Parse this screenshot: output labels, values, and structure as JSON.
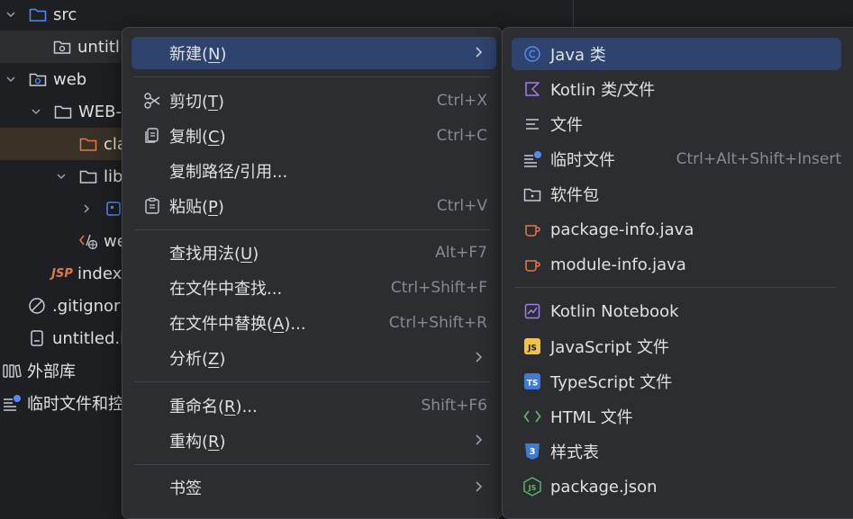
{
  "tree": {
    "items": [
      {
        "label": "src"
      },
      {
        "label": "untitl"
      },
      {
        "label": "web"
      },
      {
        "label": "WEB-"
      },
      {
        "label": "cla"
      },
      {
        "label": "lib"
      },
      {
        "label": ""
      },
      {
        "label": "we"
      },
      {
        "label": "index"
      },
      {
        "label": ".gitignor"
      },
      {
        "label": "untitled.i"
      },
      {
        "label": "外部库"
      },
      {
        "label": "临时文件和控"
      }
    ]
  },
  "menu1": {
    "new": {
      "label": "新建(",
      "mnemonic": "N",
      "suffix": ")"
    },
    "cut": {
      "label": "剪切(",
      "mnemonic": "T",
      "suffix": ")",
      "shortcut": "Ctrl+X"
    },
    "copy": {
      "label": "复制(",
      "mnemonic": "C",
      "suffix": ")",
      "shortcut": "Ctrl+C"
    },
    "copy_path": {
      "label": "复制路径/引用..."
    },
    "paste": {
      "label": "粘贴(",
      "mnemonic": "P",
      "suffix": ")",
      "shortcut": "Ctrl+V"
    },
    "find_usages": {
      "label": "查找用法(",
      "mnemonic": "U",
      "suffix": ")",
      "shortcut": "Alt+F7"
    },
    "find_in_files": {
      "label": "在文件中查找...",
      "shortcut": "Ctrl+Shift+F"
    },
    "replace_in_files": {
      "label": "在文件中替换(",
      "mnemonic": "A",
      "suffix": ")...",
      "shortcut": "Ctrl+Shift+R"
    },
    "analyze": {
      "label": "分析(",
      "mnemonic": "Z",
      "suffix": ")"
    },
    "rename": {
      "label": "重命名(",
      "mnemonic": "R",
      "suffix": ")...",
      "shortcut": "Shift+F6"
    },
    "refactor": {
      "label": "重构(",
      "mnemonic": "R",
      "suffix": ")"
    },
    "bookmarks": {
      "label": "书签"
    }
  },
  "menu2": {
    "items": [
      {
        "label": "Java 类"
      },
      {
        "label": "Kotlin 类/文件"
      },
      {
        "label": "文件"
      },
      {
        "label": "临时文件",
        "shortcut": "Ctrl+Alt+Shift+Insert"
      },
      {
        "label": "软件包"
      },
      {
        "label": "package-info.java"
      },
      {
        "label": "module-info.java"
      },
      {
        "label": "Kotlin Notebook"
      },
      {
        "label": "JavaScript 文件"
      },
      {
        "label": "TypeScript 文件"
      },
      {
        "label": "HTML 文件"
      },
      {
        "label": "样式表"
      },
      {
        "label": "package.json"
      }
    ]
  },
  "colors": {
    "background": "#1e1f22",
    "menu_bg": "#2b2d30",
    "active_item": "#2e436e",
    "accent_blue": "#548af7",
    "java_orange": "#e0794a"
  }
}
